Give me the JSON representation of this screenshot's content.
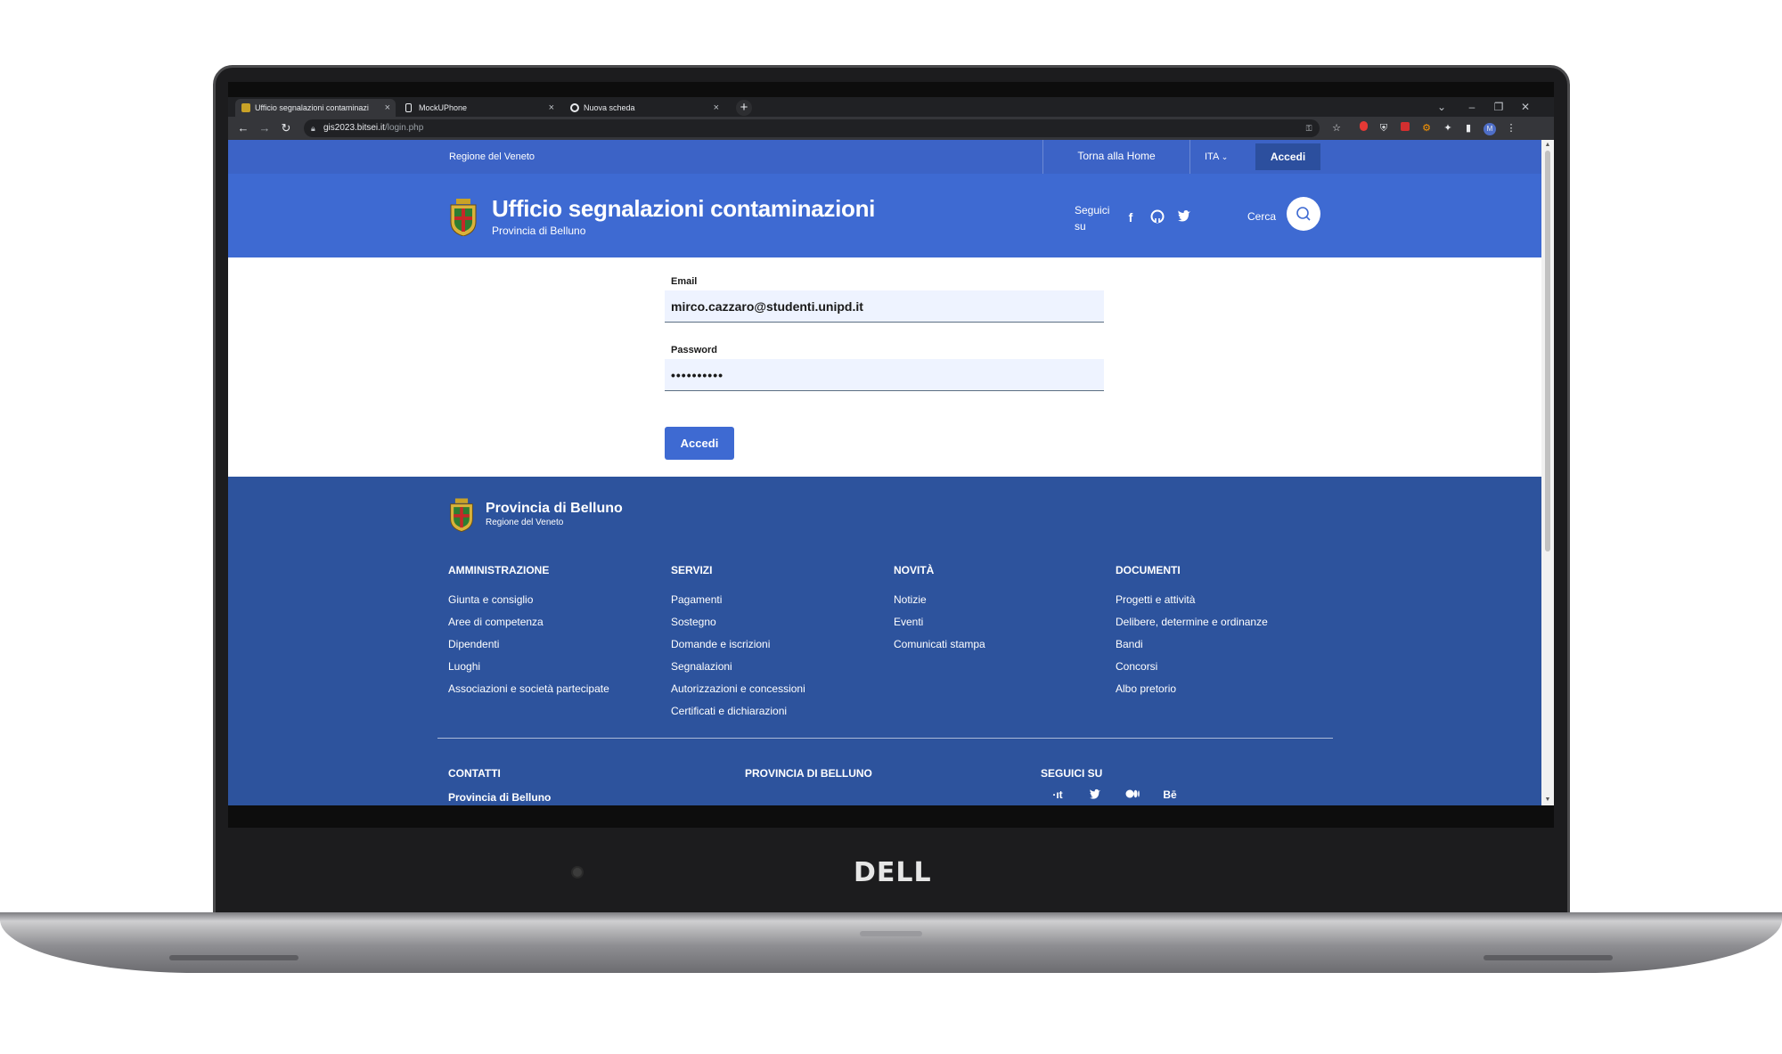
{
  "device": {
    "brand_label": "DELL"
  },
  "browser": {
    "tabs": [
      {
        "label": "Ufficio segnalazioni contaminazi",
        "active": true,
        "icon": "coat-of-arms-favicon"
      },
      {
        "label": "MockUPhone",
        "active": false,
        "icon": "phone-favicon"
      },
      {
        "label": "Nuova scheda",
        "active": false,
        "icon": "chrome-favicon"
      }
    ],
    "url_host": "gis2023.bitsei.it",
    "url_path": "/login.php"
  },
  "header_slim": {
    "region": "Regione del Veneto",
    "home_link": "Torna alla Home",
    "language": "ITA",
    "login_button": "Accedi"
  },
  "header_center": {
    "title": "Ufficio segnalazioni contaminazioni",
    "subtitle": "Provincia di Belluno",
    "follow_label": "Seguici su",
    "social_icons": [
      "facebook-icon",
      "github-icon",
      "twitter-icon"
    ],
    "search_label": "Cerca"
  },
  "login_form": {
    "email_label": "Email",
    "email_value": "mirco.cazzaro@studenti.unipd.it",
    "password_label": "Password",
    "password_value": "••••••••••",
    "submit_label": "Accedi"
  },
  "footer": {
    "title": "Provincia di Belluno",
    "subtitle": "Regione del Veneto",
    "columns": [
      {
        "heading": "AMMINISTRAZIONE",
        "links": [
          "Giunta e consiglio",
          "Aree di competenza",
          "Dipendenti",
          "Luoghi",
          "Associazioni e società partecipate"
        ]
      },
      {
        "heading": "SERVIZI",
        "links": [
          "Pagamenti",
          "Sostegno",
          "Domande e iscrizioni",
          "Segnalazioni",
          "Autorizzazioni e concessioni",
          "Certificati e dichiarazioni"
        ]
      },
      {
        "heading": "NOVITÀ",
        "links": [
          "Notizie",
          "Eventi",
          "Comunicati stampa"
        ]
      },
      {
        "heading": "DOCUMENTI",
        "links": [
          "Progetti e attività",
          "Delibere, determine e ordinanze",
          "Bandi",
          "Concorsi",
          "Albo pretorio"
        ]
      }
    ],
    "contacts_heading": "CONTATTI",
    "contacts_name": "Provincia di Belluno",
    "province_heading": "PROVINCIA DI BELLUNO",
    "follow_heading": "SEGUICI SU",
    "follow_icons": [
      {
        "name": "designers-italia-icon",
        "glyph": "·ıt"
      },
      {
        "name": "twitter-icon",
        "glyph": "🐦"
      },
      {
        "name": "medium-icon",
        "glyph": "●●"
      },
      {
        "name": "behance-icon",
        "glyph": "Bē"
      }
    ]
  },
  "colors": {
    "primary": "#3e6ad2",
    "slim_header": "#3c63c6",
    "footer": "#2d539d",
    "input_bg": "#eef3ff"
  }
}
